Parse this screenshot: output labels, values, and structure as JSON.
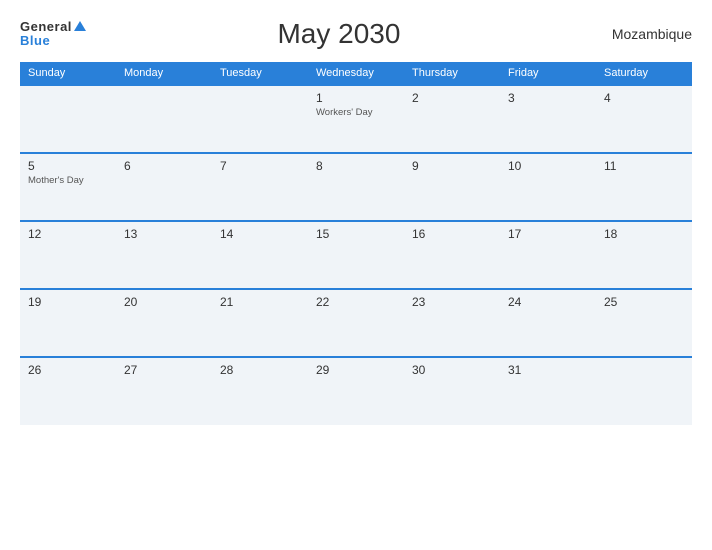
{
  "header": {
    "logo_general": "General",
    "logo_blue": "Blue",
    "title": "May 2030",
    "country": "Mozambique"
  },
  "calendar": {
    "headers": [
      "Sunday",
      "Monday",
      "Tuesday",
      "Wednesday",
      "Thursday",
      "Friday",
      "Saturday"
    ],
    "weeks": [
      [
        {
          "day": "",
          "event": ""
        },
        {
          "day": "",
          "event": ""
        },
        {
          "day": "",
          "event": ""
        },
        {
          "day": "1",
          "event": "Workers' Day"
        },
        {
          "day": "2",
          "event": ""
        },
        {
          "day": "3",
          "event": ""
        },
        {
          "day": "4",
          "event": ""
        }
      ],
      [
        {
          "day": "5",
          "event": "Mother's Day"
        },
        {
          "day": "6",
          "event": ""
        },
        {
          "day": "7",
          "event": ""
        },
        {
          "day": "8",
          "event": ""
        },
        {
          "day": "9",
          "event": ""
        },
        {
          "day": "10",
          "event": ""
        },
        {
          "day": "11",
          "event": ""
        }
      ],
      [
        {
          "day": "12",
          "event": ""
        },
        {
          "day": "13",
          "event": ""
        },
        {
          "day": "14",
          "event": ""
        },
        {
          "day": "15",
          "event": ""
        },
        {
          "day": "16",
          "event": ""
        },
        {
          "day": "17",
          "event": ""
        },
        {
          "day": "18",
          "event": ""
        }
      ],
      [
        {
          "day": "19",
          "event": ""
        },
        {
          "day": "20",
          "event": ""
        },
        {
          "day": "21",
          "event": ""
        },
        {
          "day": "22",
          "event": ""
        },
        {
          "day": "23",
          "event": ""
        },
        {
          "day": "24",
          "event": ""
        },
        {
          "day": "25",
          "event": ""
        }
      ],
      [
        {
          "day": "26",
          "event": ""
        },
        {
          "day": "27",
          "event": ""
        },
        {
          "day": "28",
          "event": ""
        },
        {
          "day": "29",
          "event": ""
        },
        {
          "day": "30",
          "event": ""
        },
        {
          "day": "31",
          "event": ""
        },
        {
          "day": "",
          "event": ""
        }
      ]
    ]
  }
}
